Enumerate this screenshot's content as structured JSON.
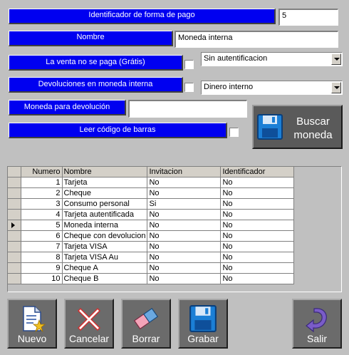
{
  "form": {
    "id_label": "Identificador de forma de pago",
    "id_value": "5",
    "name_label": "Nombre",
    "name_value": "Moneda interna",
    "sale_unpaid_label": "La venta no se paga (Grátis)",
    "auth_option": "Sin autentificacion",
    "returns_label": "Devoluciones en moneda interna",
    "returns_option": "Dinero interno",
    "return_currency_label": "Moneda para devolución",
    "return_currency_value": "",
    "barcode_label": "Leer código de barras",
    "search_button": {
      "line1": "Buscar",
      "line2": "moneda"
    }
  },
  "table": {
    "headers": [
      "Numero",
      "Nombre",
      "Invitacion",
      "Identificador"
    ],
    "selected_row": 5,
    "rows": [
      {
        "numero": "1",
        "nombre": "Tarjeta",
        "invitacion": "No",
        "identificador": "No"
      },
      {
        "numero": "2",
        "nombre": "Cheque",
        "invitacion": "No",
        "identificador": "No"
      },
      {
        "numero": "3",
        "nombre": "Consumo personal",
        "invitacion": "Si",
        "identificador": "No"
      },
      {
        "numero": "4",
        "nombre": "Tarjeta autentificada",
        "invitacion": "No",
        "identificador": "No"
      },
      {
        "numero": "5",
        "nombre": "Moneda interna",
        "invitacion": "No",
        "identificador": "No"
      },
      {
        "numero": "6",
        "nombre": "Cheque con devolucion",
        "invitacion": "No",
        "identificador": "No"
      },
      {
        "numero": "7",
        "nombre": "Tarjeta VISA",
        "invitacion": "No",
        "identificador": "No"
      },
      {
        "numero": "8",
        "nombre": "Tarjeta VISA Au",
        "invitacion": "No",
        "identificador": "No"
      },
      {
        "numero": "9",
        "nombre": "Cheque A",
        "invitacion": "No",
        "identificador": "No"
      },
      {
        "numero": "10",
        "nombre": "Cheque B",
        "invitacion": "No",
        "identificador": "No"
      }
    ]
  },
  "buttons": {
    "nuevo": "Nuevo",
    "cancelar": "Cancelar",
    "borrar": "Borrar",
    "grabar": "Grabar",
    "salir": "Salir"
  },
  "colors": {
    "label_bg": "#0000f0",
    "window_bg": "#c0c0c0"
  }
}
